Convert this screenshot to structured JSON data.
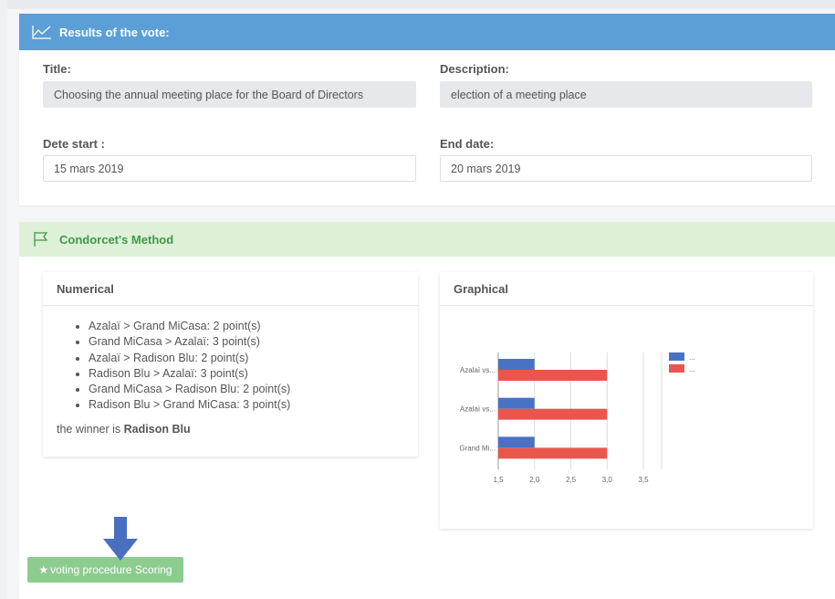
{
  "results": {
    "header": "Results of the vote:",
    "title_label": "Title:",
    "title_value": "Choosing the annual meeting place for the Board of Directors",
    "description_label": "Description:",
    "description_value": "election of a meeting place",
    "start_label": "Dete start :",
    "start_value": "15 mars 2019",
    "end_label": "End date:",
    "end_value": "20 mars 2019"
  },
  "condorcet": {
    "header": "Condorcet's Method",
    "numerical": {
      "title": "Numerical",
      "items": [
        "Azalaï > Grand MiCasa: 2 point(s)",
        "Grand MiCasa > Azalaï: 3 point(s)",
        "Azalaï > Radison Blu: 2 point(s)",
        "Radison Blu > Azalaï: 3 point(s)",
        "Grand MiCasa > Radison Blu: 2 point(s)",
        "Radison Blu > Grand MiCasa: 3 point(s)"
      ],
      "winner_prefix": "the winner is ",
      "winner_name": "Radison Blu"
    },
    "graphical": {
      "title": "Graphical"
    }
  },
  "chart_data": {
    "type": "bar",
    "orientation": "horizontal",
    "categories": [
      "Azalaï vs...",
      "Azalaï vs...",
      "Grand Mi..."
    ],
    "series": [
      {
        "name": "...",
        "color": "#4a72c4",
        "values": [
          2,
          2,
          2
        ]
      },
      {
        "name": "...",
        "color": "#e8564e",
        "values": [
          3,
          3,
          3
        ]
      }
    ],
    "xlim": [
      1.5,
      3.5
    ],
    "ticks": [
      "1,5",
      "2,0",
      "2,5",
      "3,0",
      "3,5"
    ],
    "tick_values": [
      1.5,
      2.0,
      2.5,
      3.0,
      3.5
    ],
    "grid": true,
    "legend": "right"
  },
  "button": {
    "star": "★",
    "label": "voting procedure Scoring"
  },
  "icons": {
    "chart_icon": "line-chart-icon",
    "flag_icon": "flag-icon",
    "arrow": "arrow-down-icon"
  },
  "colors": {
    "header_blue": "#5b9fd6",
    "success_bg": "#dff0d8",
    "success_text": "#3c9a48",
    "button_green": "#8dcc8f",
    "arrow_blue": "#4a6fc0"
  }
}
